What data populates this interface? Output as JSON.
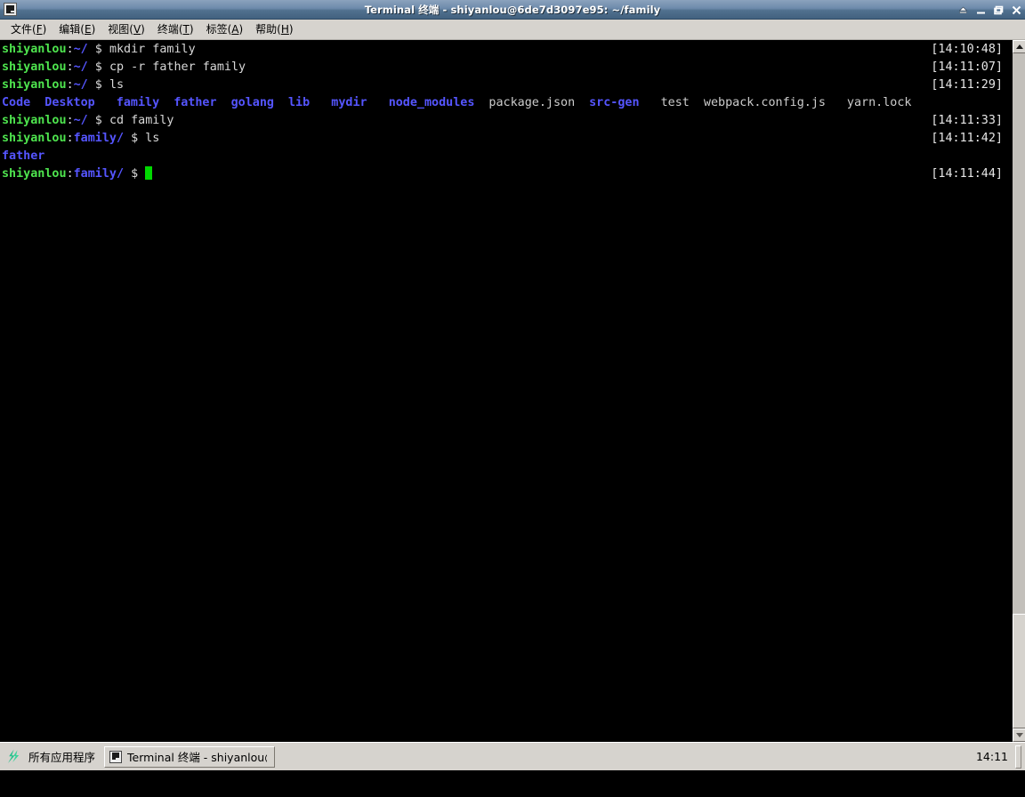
{
  "window": {
    "title": "Terminal 终端 - shiyanlou@6de7d3097e95: ~/family",
    "icon": "terminal-icon",
    "buttons": {
      "shade": "shade-button",
      "minimize": "minimize-button",
      "maximize": "maximize-button",
      "close": "close-button"
    }
  },
  "menubar": {
    "items": [
      {
        "label": "文件",
        "mnemonic": "F",
        "pre": "文件(",
        "post": ")"
      },
      {
        "label": "编辑",
        "mnemonic": "E",
        "pre": "编辑(",
        "post": ")"
      },
      {
        "label": "视图",
        "mnemonic": "V",
        "pre": "视图(",
        "post": ")"
      },
      {
        "label": "终端",
        "mnemonic": "T",
        "pre": "终端(",
        "post": ")"
      },
      {
        "label": "标签",
        "mnemonic": "A",
        "pre": "标签(",
        "post": ")"
      },
      {
        "label": "帮助",
        "mnemonic": "H",
        "pre": "帮助(",
        "post": ")"
      }
    ]
  },
  "terminal": {
    "user": "shiyanlou",
    "host": "6de7d3097e95",
    "colors": {
      "background": "#000000",
      "prompt_user": "#4ee44e",
      "prompt_path": "#5555ff",
      "foreground": "#cccccc",
      "cursor": "#00d800",
      "directory": "#5555ff"
    },
    "lines": [
      {
        "type": "prompt",
        "user": "shiyanlou",
        "colon": ":",
        "path": "~/",
        "sigil": " $ ",
        "command": "mkdir family",
        "timestamp": "[14:10:48]"
      },
      {
        "type": "prompt",
        "user": "shiyanlou",
        "colon": ":",
        "path": "~/",
        "sigil": " $ ",
        "command": "cp -r father family",
        "timestamp": "[14:11:07]"
      },
      {
        "type": "prompt",
        "user": "shiyanlou",
        "colon": ":",
        "path": "~/",
        "sigil": " $ ",
        "command": "ls",
        "timestamp": "[14:11:29]"
      },
      {
        "type": "ls-output",
        "entries": [
          {
            "name": "Code",
            "kind": "dir"
          },
          {
            "name": "Desktop",
            "kind": "dir"
          },
          {
            "name": "family",
            "kind": "dir"
          },
          {
            "name": "father",
            "kind": "dir"
          },
          {
            "name": "golang",
            "kind": "dir"
          },
          {
            "name": "lib",
            "kind": "dir"
          },
          {
            "name": "mydir",
            "kind": "dir"
          },
          {
            "name": "node_modules",
            "kind": "dir"
          },
          {
            "name": "package.json",
            "kind": "file"
          },
          {
            "name": "src-gen",
            "kind": "dir"
          },
          {
            "name": "test",
            "kind": "file"
          },
          {
            "name": "webpack.config.js",
            "kind": "file"
          },
          {
            "name": "yarn.lock",
            "kind": "file"
          }
        ],
        "timestamp": ""
      },
      {
        "type": "prompt",
        "user": "shiyanlou",
        "colon": ":",
        "path": "~/",
        "sigil": " $ ",
        "command": "cd family",
        "timestamp": "[14:11:33]"
      },
      {
        "type": "prompt",
        "user": "shiyanlou",
        "colon": ":",
        "path": "family/",
        "sigil": " $ ",
        "command": "ls",
        "timestamp": "[14:11:42]"
      },
      {
        "type": "ls-output",
        "entries": [
          {
            "name": "father",
            "kind": "dir"
          }
        ],
        "timestamp": ""
      },
      {
        "type": "prompt-cursor",
        "user": "shiyanlou",
        "colon": ":",
        "path": "family/",
        "sigil": " $ ",
        "command": "",
        "timestamp": "[14:11:44]"
      }
    ]
  },
  "scrollbar": {
    "up_arrow": "scroll-up-icon",
    "down_arrow": "scroll-down-icon"
  },
  "taskbar": {
    "start_label": "所有应用程序",
    "start_icon": "shiyanlou-logo-icon",
    "tasks": [
      {
        "label": "Terminal 终端 - shiyanlou@···",
        "icon": "terminal-icon",
        "active": true
      }
    ],
    "clock": "14:11"
  }
}
